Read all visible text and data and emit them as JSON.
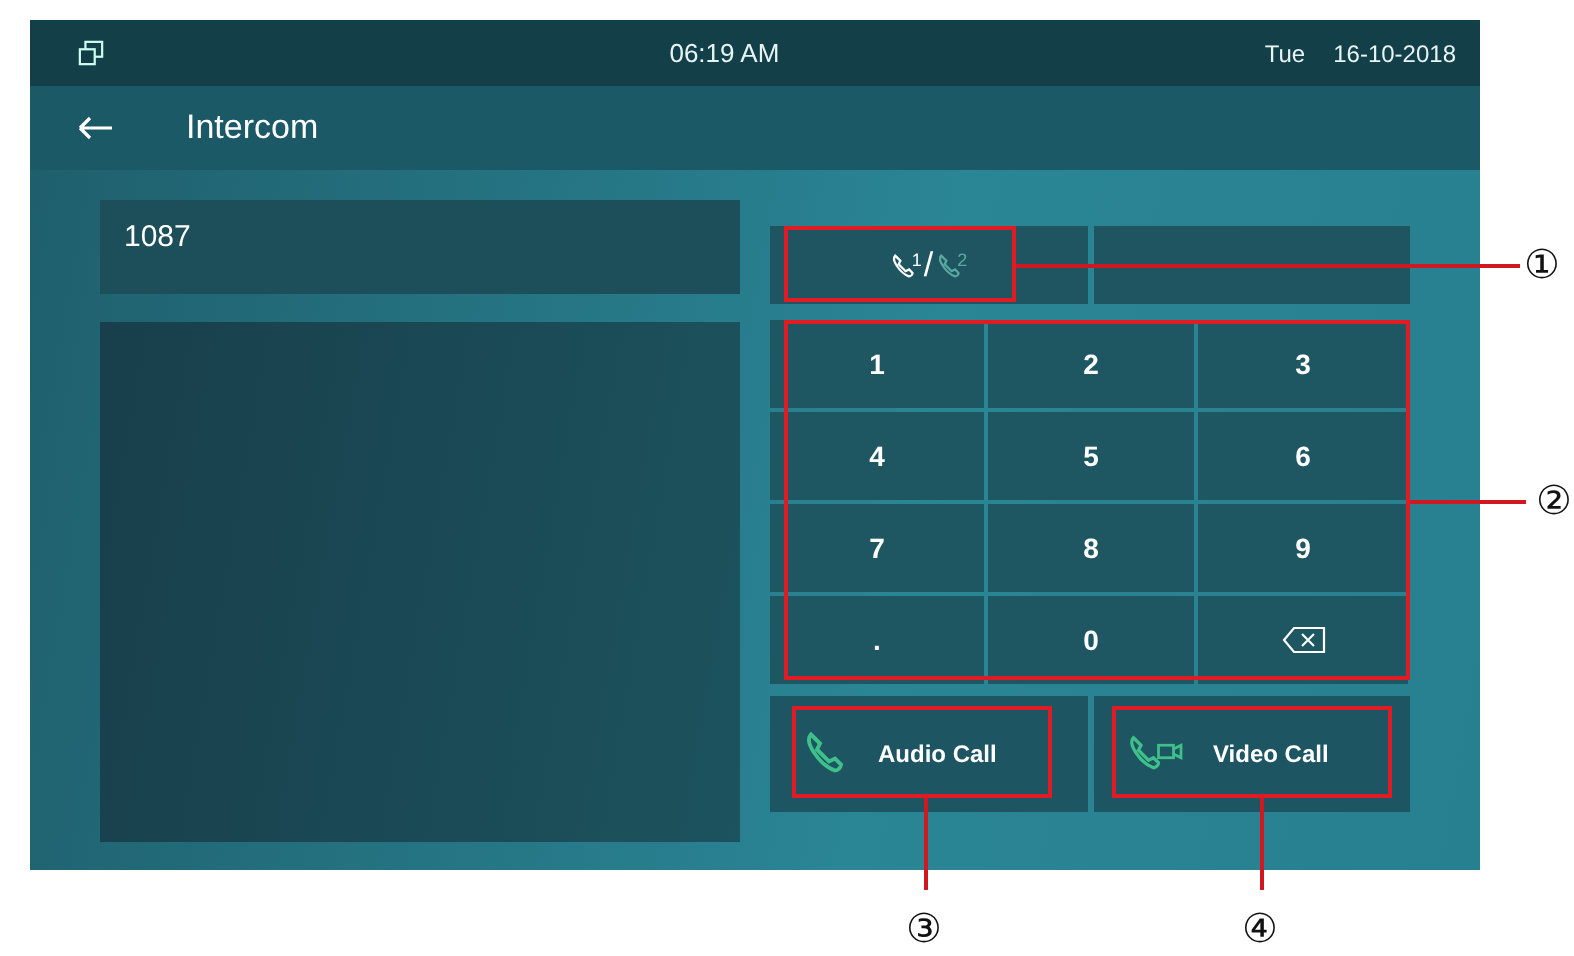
{
  "status_bar": {
    "time": "06:19 AM",
    "day": "Tue",
    "date": "16-10-2018"
  },
  "title_bar": {
    "title": "Intercom"
  },
  "number_field": {
    "value": "1087"
  },
  "line_switch": {
    "separator": "/",
    "lines": [
      {
        "label": "1",
        "selected": true
      },
      {
        "label": "2",
        "selected": false
      }
    ]
  },
  "keypad": [
    {
      "kind": "digit",
      "label": "1"
    },
    {
      "kind": "digit",
      "label": "2"
    },
    {
      "kind": "digit",
      "label": "3"
    },
    {
      "kind": "digit",
      "label": "4"
    },
    {
      "kind": "digit",
      "label": "5"
    },
    {
      "kind": "digit",
      "label": "6"
    },
    {
      "kind": "digit",
      "label": "7"
    },
    {
      "kind": "digit",
      "label": "8"
    },
    {
      "kind": "digit",
      "label": "9"
    },
    {
      "kind": "digit",
      "label": "."
    },
    {
      "kind": "digit",
      "label": "0"
    },
    {
      "kind": "backspace"
    }
  ],
  "call_buttons": [
    {
      "kind": "audio",
      "label": "Audio Call"
    },
    {
      "kind": "video",
      "label": "Video Call"
    }
  ],
  "callouts": [
    {
      "label": "①"
    },
    {
      "label": "②"
    },
    {
      "label": "③"
    },
    {
      "label": "④"
    }
  ]
}
